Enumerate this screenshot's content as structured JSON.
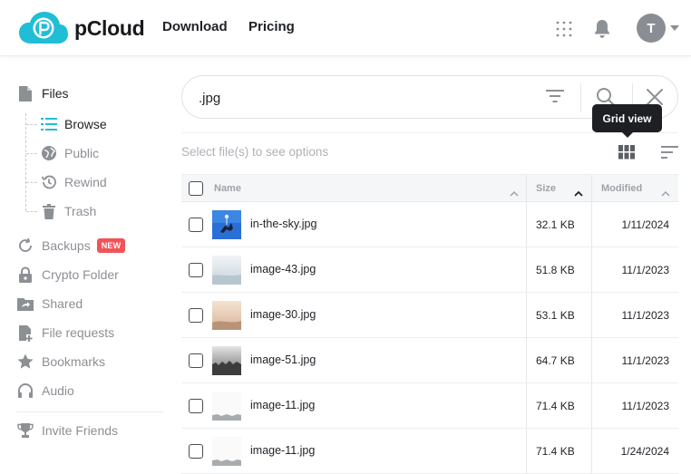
{
  "app": {
    "brand": "pCloud",
    "brand_color": "#20bed6"
  },
  "nav": {
    "download": "Download",
    "pricing": "Pricing"
  },
  "user": {
    "avatar_initial": "T"
  },
  "sidebar": {
    "files": "Files",
    "sub": [
      {
        "label": "Browse",
        "icon": "list-icon",
        "active": true
      },
      {
        "label": "Public",
        "icon": "globe-icon"
      },
      {
        "label": "Rewind",
        "icon": "rewind-clock-icon"
      },
      {
        "label": "Trash",
        "icon": "trash-icon"
      }
    ],
    "backups": "Backups",
    "new_badge": "NEW",
    "crypto": "Crypto Folder",
    "shared": "Shared",
    "file_requests": "File requests",
    "bookmarks": "Bookmarks",
    "audio": "Audio",
    "invite": "Invite Friends"
  },
  "search": {
    "value": ".jpg"
  },
  "tooltip": {
    "text": "Grid view"
  },
  "toolbar": {
    "select_hint": "Select file(s) to see options"
  },
  "table": {
    "headers": {
      "name": "Name",
      "size": "Size",
      "modified": "Modified"
    },
    "rows": [
      {
        "name": "in-the-sky.jpg",
        "size": "32.1 KB",
        "modified": "1/11/2024"
      },
      {
        "name": "image-43.jpg",
        "size": "51.8 KB",
        "modified": "11/1/2023"
      },
      {
        "name": "image-30.jpg",
        "size": "53.1 KB",
        "modified": "11/1/2023"
      },
      {
        "name": "image-51.jpg",
        "size": "64.7 KB",
        "modified": "11/1/2023"
      },
      {
        "name": "image-11.jpg",
        "size": "71.4 KB",
        "modified": "11/1/2023"
      },
      {
        "name": "image-11.jpg",
        "size": "71.4 KB",
        "modified": "1/24/2024"
      }
    ]
  }
}
